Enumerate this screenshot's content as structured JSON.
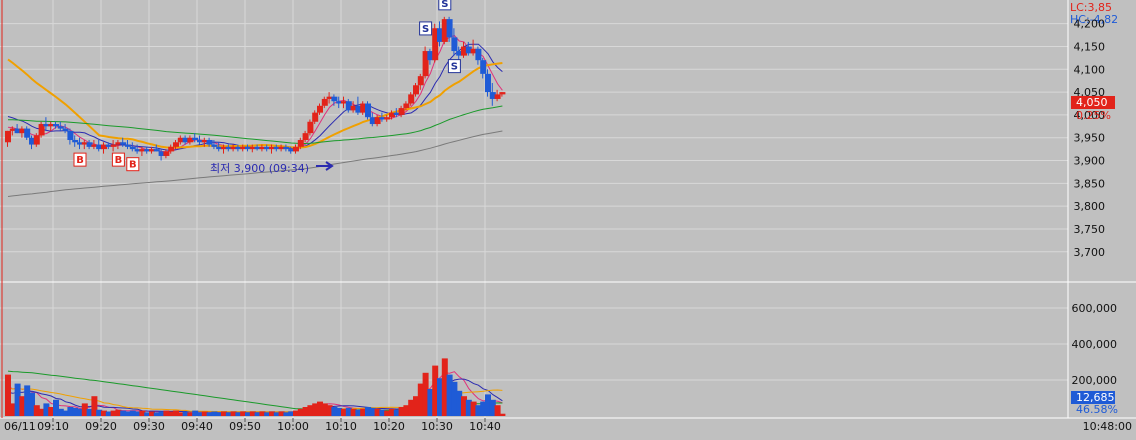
{
  "header": {
    "lc": "LC:3,85",
    "hc": "HC:-4,82"
  },
  "colors": {
    "up": "#e2231a",
    "down": "#1f5bd6",
    "ma_orange": "#f0a000",
    "ma_green": "#1a9a2a",
    "ma_gray": "#7a7a7a",
    "ma_blue": "#2b2bb0",
    "ma_pink": "#e0307a",
    "grid": "#d8d8d8",
    "background": "#c0c0c0"
  },
  "price_axis": {
    "ticks": [
      "4,200",
      "4,150",
      "4,100",
      "4,050",
      "4,000",
      "3,950",
      "3,900",
      "3,850",
      "3,800",
      "3,750",
      "3,700"
    ],
    "current": "4,050",
    "change": "0.25%"
  },
  "volume_axis": {
    "ticks": [
      "600,000",
      "400,000",
      "200,000"
    ],
    "current": "12,685",
    "ratio": "46.58%"
  },
  "time_axis": {
    "labels": [
      "06/11",
      "09:10",
      "09:20",
      "09:30",
      "09:40",
      "09:50",
      "10:00",
      "10:10",
      "10:20",
      "10:30",
      "10:40",
      "10:48:00"
    ]
  },
  "annotation": {
    "low_text": "최저 3,900 (09:34)"
  },
  "chart_data": {
    "type": "candlestick",
    "ylim": [
      3660,
      4230
    ],
    "volume_ylim": [
      0,
      700000
    ],
    "x_range": [
      "09:00",
      "10:48"
    ],
    "candles": [
      [
        0,
        3940,
        3965,
        3930,
        3965
      ],
      [
        2,
        3965,
        3975,
        3955,
        3970
      ],
      [
        4,
        3970,
        3980,
        3960,
        3960
      ],
      [
        6,
        3960,
        3975,
        3950,
        3970
      ],
      [
        8,
        3970,
        3975,
        3945,
        3950
      ],
      [
        10,
        3950,
        3955,
        3925,
        3935
      ],
      [
        12,
        3935,
        3960,
        3930,
        3955
      ],
      [
        14,
        3955,
        3985,
        3950,
        3980
      ],
      [
        16,
        3980,
        3995,
        3965,
        3975
      ],
      [
        18,
        3975,
        3985,
        3965,
        3980
      ],
      [
        20,
        3980,
        3985,
        3970,
        3975
      ],
      [
        22,
        3975,
        3985,
        3965,
        3970
      ],
      [
        24,
        3970,
        3980,
        3960,
        3965
      ],
      [
        26,
        3965,
        3970,
        3935,
        3945
      ],
      [
        28,
        3945,
        3955,
        3930,
        3940
      ],
      [
        30,
        3940,
        3950,
        3925,
        3935
      ],
      [
        32,
        3935,
        3945,
        3925,
        3940
      ],
      [
        34,
        3940,
        3945,
        3925,
        3930
      ],
      [
        36,
        3930,
        3945,
        3925,
        3935
      ],
      [
        38,
        3935,
        3945,
        3920,
        3925
      ],
      [
        40,
        3925,
        3940,
        3915,
        3935
      ],
      [
        42,
        3935,
        3940,
        3925,
        3930
      ],
      [
        44,
        3930,
        3945,
        3920,
        3935
      ],
      [
        46,
        3935,
        3945,
        3925,
        3940
      ],
      [
        48,
        3940,
        3950,
        3930,
        3935
      ],
      [
        50,
        3935,
        3945,
        3925,
        3930
      ],
      [
        52,
        3930,
        3940,
        3920,
        3925
      ],
      [
        54,
        3925,
        3935,
        3915,
        3920
      ],
      [
        56,
        3920,
        3930,
        3910,
        3925
      ],
      [
        58,
        3925,
        3930,
        3915,
        3920
      ],
      [
        60,
        3920,
        3930,
        3915,
        3925
      ],
      [
        62,
        3925,
        3935,
        3920,
        3920
      ],
      [
        64,
        3920,
        3925,
        3900,
        3910
      ],
      [
        66,
        3910,
        3925,
        3905,
        3920
      ],
      [
        68,
        3920,
        3935,
        3915,
        3930
      ],
      [
        70,
        3930,
        3945,
        3925,
        3940
      ],
      [
        72,
        3940,
        3955,
        3935,
        3950
      ],
      [
        74,
        3950,
        3955,
        3935,
        3940
      ],
      [
        76,
        3940,
        3955,
        3935,
        3950
      ],
      [
        78,
        3950,
        3960,
        3940,
        3945
      ],
      [
        80,
        3945,
        3955,
        3935,
        3940
      ],
      [
        82,
        3940,
        3950,
        3930,
        3945
      ],
      [
        84,
        3945,
        3950,
        3930,
        3935
      ],
      [
        86,
        3935,
        3945,
        3925,
        3930
      ],
      [
        88,
        3930,
        3940,
        3920,
        3925
      ],
      [
        90,
        3925,
        3935,
        3915,
        3930
      ],
      [
        92,
        3930,
        3935,
        3920,
        3925
      ],
      [
        94,
        3925,
        3935,
        3920,
        3930
      ],
      [
        96,
        3930,
        3935,
        3920,
        3925
      ],
      [
        98,
        3925,
        3935,
        3920,
        3930
      ],
      [
        100,
        3930,
        3935,
        3920,
        3925
      ],
      [
        102,
        3925,
        3935,
        3918,
        3930
      ],
      [
        104,
        3930,
        3935,
        3922,
        3925
      ],
      [
        106,
        3925,
        3935,
        3920,
        3930
      ],
      [
        108,
        3930,
        3935,
        3920,
        3925
      ],
      [
        110,
        3925,
        3935,
        3915,
        3930
      ],
      [
        112,
        3930,
        3935,
        3920,
        3925
      ],
      [
        114,
        3925,
        3935,
        3920,
        3930
      ],
      [
        116,
        3930,
        3935,
        3920,
        3925
      ],
      [
        118,
        3925,
        3930,
        3915,
        3920
      ],
      [
        120,
        3920,
        3935,
        3915,
        3930
      ],
      [
        122,
        3930,
        3950,
        3925,
        3945
      ],
      [
        124,
        3945,
        3965,
        3940,
        3960
      ],
      [
        126,
        3960,
        3990,
        3955,
        3985
      ],
      [
        128,
        3985,
        4010,
        3980,
        4005
      ],
      [
        130,
        4005,
        4025,
        4000,
        4020
      ],
      [
        132,
        4020,
        4040,
        4015,
        4035
      ],
      [
        134,
        4035,
        4050,
        4025,
        4040
      ],
      [
        136,
        4040,
        4045,
        4020,
        4030
      ],
      [
        138,
        4030,
        4040,
        4015,
        4025
      ],
      [
        140,
        4025,
        4040,
        4015,
        4030
      ],
      [
        142,
        4030,
        4035,
        4005,
        4010
      ],
      [
        144,
        4010,
        4030,
        4005,
        4020
      ],
      [
        146,
        4020,
        4040,
        4000,
        4005
      ],
      [
        148,
        4005,
        4030,
        4000,
        4025
      ],
      [
        150,
        4025,
        4030,
        3990,
        3995
      ],
      [
        152,
        3995,
        4005,
        3975,
        3980
      ],
      [
        154,
        3980,
        4000,
        3975,
        3995
      ],
      [
        156,
        3995,
        4005,
        3985,
        3990
      ],
      [
        158,
        3990,
        4000,
        3985,
        3995
      ],
      [
        160,
        3995,
        4010,
        3990,
        4005
      ],
      [
        162,
        4005,
        4015,
        3995,
        4000
      ],
      [
        164,
        4000,
        4020,
        3995,
        4015
      ],
      [
        166,
        4015,
        4030,
        4010,
        4025
      ],
      [
        168,
        4025,
        4050,
        4020,
        4045
      ],
      [
        170,
        4045,
        4070,
        4040,
        4065
      ],
      [
        172,
        4065,
        4090,
        4055,
        4085
      ],
      [
        174,
        4085,
        4150,
        4080,
        4140
      ],
      [
        176,
        4140,
        4145,
        4110,
        4120
      ],
      [
        178,
        4120,
        4200,
        4115,
        4190
      ],
      [
        180,
        4190,
        4205,
        4150,
        4160
      ],
      [
        182,
        4160,
        4215,
        4155,
        4210
      ],
      [
        184,
        4210,
        4215,
        4160,
        4170
      ],
      [
        186,
        4170,
        4190,
        4130,
        4140
      ],
      [
        188,
        4140,
        4150,
        4120,
        4130
      ],
      [
        190,
        4130,
        4160,
        4125,
        4150
      ],
      [
        192,
        4150,
        4160,
        4130,
        4135
      ],
      [
        194,
        4135,
        4165,
        4130,
        4145
      ],
      [
        196,
        4145,
        4150,
        4110,
        4120
      ],
      [
        198,
        4120,
        4125,
        4080,
        4090
      ],
      [
        200,
        4090,
        4100,
        4040,
        4050
      ],
      [
        202,
        4050,
        4070,
        4020,
        4035
      ],
      [
        204,
        4035,
        4055,
        4030,
        4045
      ],
      [
        206,
        4045,
        4050,
        4040,
        4050
      ]
    ],
    "volumes": [
      [
        0,
        230000
      ],
      [
        2,
        70000
      ],
      [
        4,
        180000
      ],
      [
        6,
        110000
      ],
      [
        8,
        170000
      ],
      [
        10,
        130000
      ],
      [
        12,
        60000
      ],
      [
        14,
        40000
      ],
      [
        16,
        70000
      ],
      [
        18,
        50000
      ],
      [
        20,
        90000
      ],
      [
        22,
        40000
      ],
      [
        24,
        30000
      ],
      [
        26,
        50000
      ],
      [
        28,
        45000
      ],
      [
        30,
        40000
      ],
      [
        32,
        70000
      ],
      [
        34,
        40000
      ],
      [
        36,
        110000
      ],
      [
        38,
        35000
      ],
      [
        40,
        30000
      ],
      [
        42,
        25000
      ],
      [
        44,
        30000
      ],
      [
        46,
        35000
      ],
      [
        48,
        30000
      ],
      [
        50,
        25000
      ],
      [
        52,
        30000
      ],
      [
        54,
        25000
      ],
      [
        56,
        30000
      ],
      [
        58,
        20000
      ],
      [
        60,
        25000
      ],
      [
        62,
        20000
      ],
      [
        64,
        25000
      ],
      [
        66,
        30000
      ],
      [
        68,
        25000
      ],
      [
        70,
        30000
      ],
      [
        72,
        20000
      ],
      [
        74,
        25000
      ],
      [
        76,
        20000
      ],
      [
        78,
        30000
      ],
      [
        80,
        20000
      ],
      [
        82,
        25000
      ],
      [
        84,
        20000
      ],
      [
        86,
        25000
      ],
      [
        88,
        20000
      ],
      [
        90,
        25000
      ],
      [
        92,
        20000
      ],
      [
        94,
        25000
      ],
      [
        96,
        20000
      ],
      [
        98,
        25000
      ],
      [
        100,
        20000
      ],
      [
        102,
        25000
      ],
      [
        104,
        20000
      ],
      [
        106,
        25000
      ],
      [
        108,
        20000
      ],
      [
        110,
        25000
      ],
      [
        112,
        20000
      ],
      [
        114,
        25000
      ],
      [
        116,
        20000
      ],
      [
        118,
        25000
      ],
      [
        120,
        30000
      ],
      [
        122,
        40000
      ],
      [
        124,
        50000
      ],
      [
        126,
        60000
      ],
      [
        128,
        70000
      ],
      [
        130,
        80000
      ],
      [
        132,
        70000
      ],
      [
        134,
        60000
      ],
      [
        136,
        50000
      ],
      [
        138,
        45000
      ],
      [
        140,
        40000
      ],
      [
        142,
        45000
      ],
      [
        144,
        40000
      ],
      [
        146,
        35000
      ],
      [
        148,
        40000
      ],
      [
        150,
        50000
      ],
      [
        152,
        45000
      ],
      [
        154,
        40000
      ],
      [
        156,
        35000
      ],
      [
        158,
        30000
      ],
      [
        160,
        40000
      ],
      [
        162,
        35000
      ],
      [
        164,
        50000
      ],
      [
        166,
        60000
      ],
      [
        168,
        90000
      ],
      [
        170,
        110000
      ],
      [
        172,
        180000
      ],
      [
        174,
        240000
      ],
      [
        176,
        150000
      ],
      [
        178,
        280000
      ],
      [
        180,
        210000
      ],
      [
        182,
        320000
      ],
      [
        184,
        230000
      ],
      [
        186,
        190000
      ],
      [
        188,
        140000
      ],
      [
        190,
        110000
      ],
      [
        192,
        90000
      ],
      [
        194,
        80000
      ],
      [
        196,
        60000
      ],
      [
        198,
        80000
      ],
      [
        200,
        120000
      ],
      [
        202,
        90000
      ],
      [
        204,
        60000
      ],
      [
        206,
        12685
      ]
    ]
  }
}
